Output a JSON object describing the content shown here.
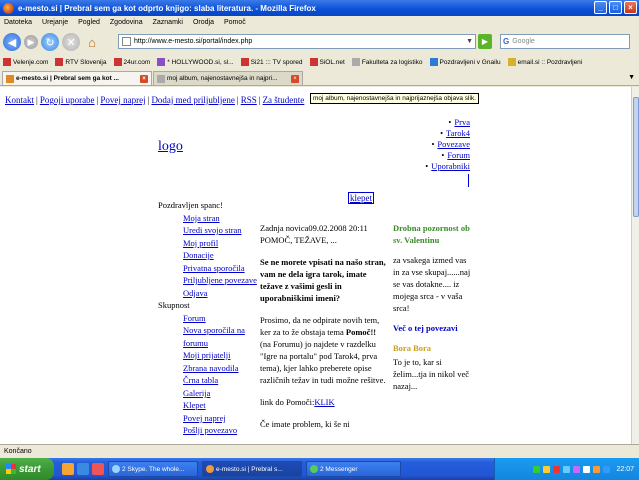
{
  "window": {
    "title": "e-mesto.si | Prebral sem ga kot odprto knjigo: slaba literatura. - Mozilla Firefox"
  },
  "menu": [
    "Datoteka",
    "Urejanje",
    "Pogled",
    "Zgodovina",
    "Zaznamki",
    "Orodja",
    "Pomoč"
  ],
  "url": "http://www.e-mesto.si/portal/index.php",
  "search": {
    "placeholder": "Google",
    "engine": "G"
  },
  "bookmarks": [
    "Velenje.com",
    "RTV Slovenija",
    "24ur.com",
    "* HOLLYWOOD.si, sl...",
    "Si21 ::: TV spored",
    "SiOL.net",
    "Fakulteta za logistiko",
    "Pozdravljeni v Gnailu",
    "email.si :: Pozdravljeni"
  ],
  "tabs": [
    {
      "label": "e-mesto.si | Prebral sem ga kot ...",
      "active": true
    },
    {
      "label": "moj album, najenostavnejša in najpri...",
      "active": false
    }
  ],
  "topnav": [
    "Kontakt",
    "Pogoji uporabe",
    "Povej naprej",
    "Dodaj med priljubljene",
    "RSS",
    "Za študente"
  ],
  "tooltip": "moj album, najenostavnejša in najprijaznejša objava slik.",
  "logo": "logo",
  "rightmenu": [
    "Prva",
    "Tarok4",
    "Povezave",
    "Forum",
    "Uporabniki"
  ],
  "klepet": "klepet",
  "left": {
    "greeting": "Pozdravljen spanc!",
    "links1": [
      "Moja stran",
      "Uredi svojo stran",
      "Moj profil",
      "Donacije",
      "Privatna sporočila",
      "Priljubljene povezave",
      "Odjava"
    ],
    "group": "Skupnost",
    "links2": [
      "Forum",
      "Nova sporočila na forumu",
      "Moji prijatelji",
      "Zbrana navodila",
      "Črna tabla",
      "Galerija",
      "Klepet",
      "Povej naprej",
      "Pošlji povezavo"
    ]
  },
  "mid": {
    "p1": "Zadnja novica09.02.2008 20:11 POMOČ, TEŽAVE, ...",
    "p2": "Se ne morete vpisati na našo stran, vam ne dela igra tarok, imate težave z vašimi gesli in uporabniškimi imeni?",
    "p3a": "Prosimo, da ne odpirate novih tem, ker za to že obstaja tema ",
    "p3b": "Pomoč!!",
    "p3c": " (na Forumu) jo najdete v razdelku \"Igre na portalu\" pod Tarok4, prva tema), kjer lahko preberete opise različnih težav in tudi možne rešitve.",
    "p4": "link do Pomoči:",
    "p4link": "KLIK",
    "p5": "Če imate problem, ki še ni"
  },
  "right": {
    "h1": "Drobna pozornost ob sv. Valentinu",
    "t1": "za vsakega izmed vas in za vse skupaj......naj se vas dotakne.... iz mojega srca - v vaša srca!",
    "h2": "Več o tej povezavi",
    "h3": "Bora Bora",
    "t3": "To je to, kar si želim...tja in nikol več nazaj..."
  },
  "status": "Končano",
  "taskbar": {
    "start": "start",
    "tasks": [
      "2 Skype. The whole...",
      "e-mesto.si | Prebral s...",
      "2 Messenger"
    ],
    "clock": "22:07"
  },
  "colors": {
    "link": "#0000cc",
    "green": "#3a8a2a",
    "titlebar": "#0a4fd6"
  }
}
